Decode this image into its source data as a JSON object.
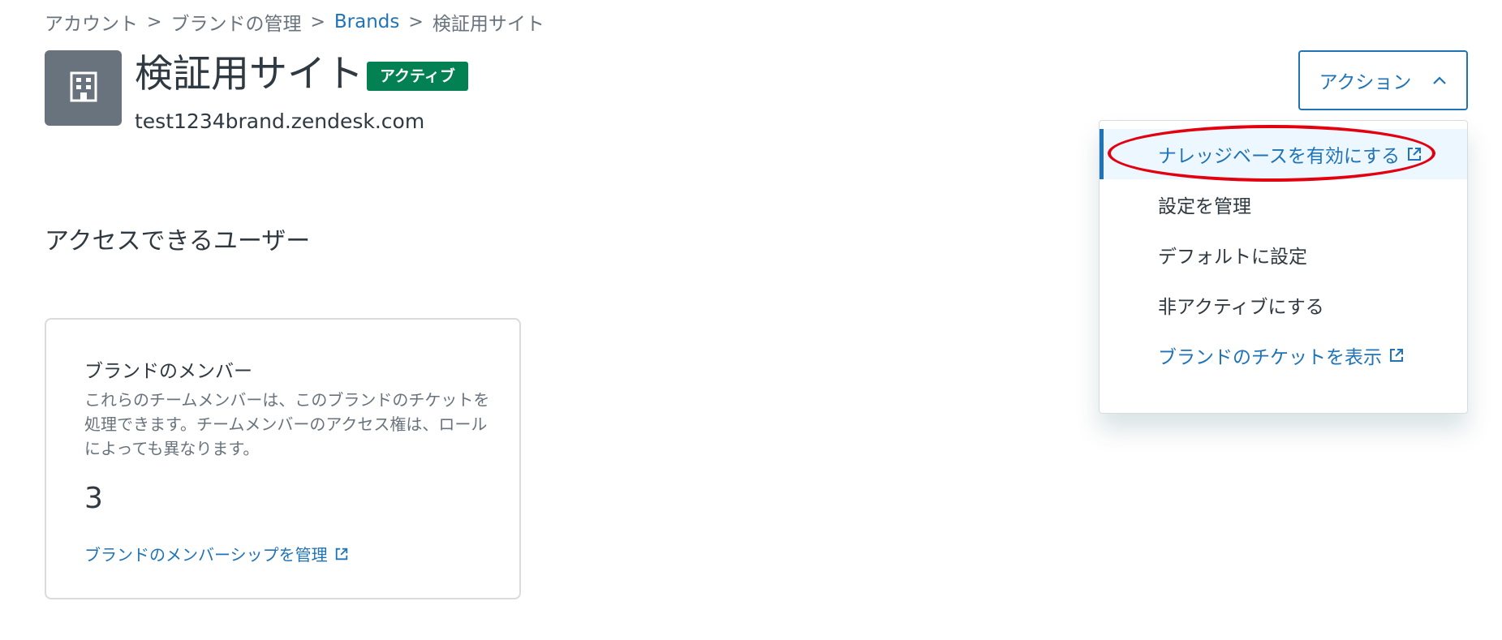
{
  "breadcrumb": {
    "items": [
      "アカウント",
      "ブランドの管理",
      "Brands",
      "検証用サイト"
    ],
    "separator": ">"
  },
  "header": {
    "logo_icon": "building-icon",
    "title": "検証用サイト",
    "status": "アクティブ",
    "subdomain": "test1234brand.zendesk.com"
  },
  "actions": {
    "button_label": "アクション",
    "menu": [
      {
        "label": "ナレッジベースを有効にする",
        "external": true
      },
      {
        "label": "設定を管理",
        "external": false
      },
      {
        "label": "デフォルトに設定",
        "external": false
      },
      {
        "label": "非アクティブにする",
        "external": false
      },
      {
        "label": "ブランドのチケットを表示",
        "external": true
      }
    ]
  },
  "section": {
    "title": "アクセスできるユーザー"
  },
  "card": {
    "title": "ブランドのメンバー",
    "description": "これらのチームメンバーは、このブランドのチケットを処理できます。チームメンバーのアクセス権は、ロールによっても異なります。",
    "count": "3",
    "link": "ブランドのメンバーシップを管理"
  },
  "colors": {
    "accent": "#1f73b7",
    "active_badge": "#038153",
    "highlight": "#e3000f",
    "logo_bg": "#68737d"
  }
}
